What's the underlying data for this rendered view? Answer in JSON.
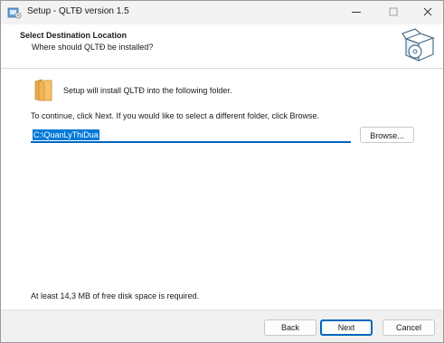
{
  "window": {
    "title": "Setup - QLTĐ version 1.5"
  },
  "header": {
    "title": "Select Destination Location",
    "subtitle": "Where should QLTĐ be installed?",
    "icon": "setup-box-cd-icon"
  },
  "main": {
    "folder_icon": "folder-icon",
    "info_text": "Setup will install QLTĐ into the following folder.",
    "continue_text": "To continue, click Next. If you would like to select a different folder, click Browse.",
    "path_value": "C:\\QuanLyThiDua",
    "browse_label": "Browse...",
    "disk_space_text": "At least 14,3 MB of free disk space is required."
  },
  "footer": {
    "back_label": "Back",
    "next_label": "Next",
    "cancel_label": "Cancel"
  },
  "colors": {
    "accent": "#0067c0",
    "selection": "#0078d7",
    "folder": "#f5c26b"
  }
}
